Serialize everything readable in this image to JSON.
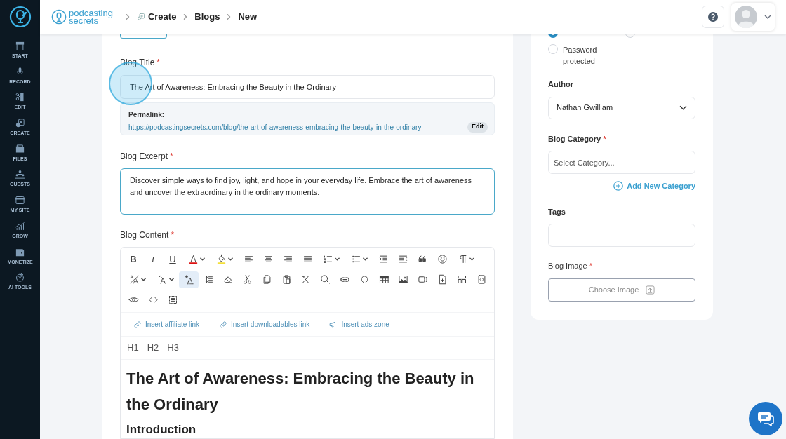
{
  "sidebar": {
    "items": [
      {
        "label": "START"
      },
      {
        "label": "RECORD"
      },
      {
        "label": "EDIT"
      },
      {
        "label": "CREATE"
      },
      {
        "label": "FILES"
      },
      {
        "label": "GUESTS"
      },
      {
        "label": "MY SITE"
      },
      {
        "label": "GROW"
      },
      {
        "label": "MONETIZE"
      },
      {
        "label": "AI TOOLS"
      }
    ]
  },
  "header": {
    "brand": {
      "line1": "podcasting",
      "line2": "secrets"
    },
    "breadcrumb": [
      {
        "label": "Create"
      },
      {
        "label": "Blogs"
      },
      {
        "label": "New"
      }
    ]
  },
  "form": {
    "title": {
      "label": "Blog Title",
      "required_mark": "*",
      "value": "The Art of Awareness: Embracing the Beauty in the Ordinary"
    },
    "permalink": {
      "label": "Permalink:",
      "url": "https://podcastingsecrets.com/blog/the-art-of-awareness-embracing-the-beauty-in-the-ordinary",
      "edit": "Edit"
    },
    "excerpt": {
      "label": "Blog Excerpt",
      "required_mark": "*",
      "value": "Discover simple ways to find joy, light, and hope in your everyday life. Embrace the art of awareness and uncover the extraordinary in the ordinary moments."
    },
    "content": {
      "label": "Blog Content",
      "required_mark": "*",
      "toolbar_rows": [
        [
          {
            "kind": "text",
            "label": "B",
            "selected": false
          },
          {
            "kind": "text",
            "label": "I",
            "selected": false
          },
          {
            "kind": "text",
            "label": "U",
            "selected": false
          },
          {
            "kind": "dropdown",
            "selected": false
          },
          {
            "kind": "dropdown",
            "selected": false
          },
          {
            "kind": "icon",
            "selected": false
          },
          {
            "kind": "icon",
            "selected": false
          },
          {
            "kind": "icon",
            "selected": false
          },
          {
            "kind": "icon",
            "selected": false
          },
          {
            "kind": "dropdown",
            "selected": false
          },
          {
            "kind": "dropdown",
            "selected": false
          },
          {
            "kind": "icon",
            "selected": false
          },
          {
            "kind": "icon",
            "selected": false
          },
          {
            "kind": "icon",
            "selected": false
          },
          {
            "kind": "icon",
            "selected": false
          },
          {
            "kind": "dropdown",
            "selected": false
          }
        ],
        [
          {
            "kind": "dropdown",
            "selected": false
          },
          {
            "kind": "dropdown",
            "selected": false
          },
          {
            "kind": "icon",
            "selected": true
          },
          {
            "kind": "icon",
            "selected": false
          },
          {
            "kind": "icon",
            "selected": false
          },
          {
            "kind": "icon",
            "selected": false
          },
          {
            "kind": "icon",
            "selected": false
          },
          {
            "kind": "icon",
            "selected": false
          },
          {
            "kind": "icon",
            "selected": false
          },
          {
            "kind": "icon",
            "selected": false
          },
          {
            "kind": "icon",
            "selected": false
          },
          {
            "kind": "icon",
            "selected": false
          },
          {
            "kind": "icon",
            "selected": false
          },
          {
            "kind": "icon",
            "selected": false
          },
          {
            "kind": "icon",
            "selected": false
          },
          {
            "kind": "icon",
            "selected": false
          },
          {
            "kind": "icon",
            "selected": false
          },
          {
            "kind": "icon",
            "selected": false
          }
        ],
        [
          {
            "kind": "icon",
            "selected": false
          },
          {
            "kind": "icon",
            "selected": false
          },
          {
            "kind": "icon",
            "selected": false
          }
        ]
      ],
      "insert_links": [
        {
          "label": "Insert affiliate link"
        },
        {
          "label": "Insert downloadables link"
        },
        {
          "label": "Insert ads zone"
        }
      ],
      "heading_buttons": [
        "H1",
        "H2",
        "H3"
      ],
      "blocks": [
        {
          "kind": "h1",
          "text": "The Art of Awareness: Embracing the Beauty in the Ordinary"
        },
        {
          "kind": "h2",
          "text": "Introduction"
        }
      ]
    }
  },
  "settings": {
    "visibility": [
      {
        "selected": true
      },
      {
        "selected": false
      },
      {
        "label": "Password protected",
        "selected": false
      }
    ],
    "author": {
      "label": "Author",
      "value": "Nathan Gwilliam"
    },
    "category": {
      "label": "Blog Category",
      "required_mark": "*",
      "placeholder": "Select Category...",
      "add": "Add New Category"
    },
    "tags": {
      "label": "Tags"
    },
    "image": {
      "label": "Blog Image",
      "required_mark": "*",
      "button": "Choose Image"
    }
  },
  "click_indicator": {
    "visible": true
  }
}
